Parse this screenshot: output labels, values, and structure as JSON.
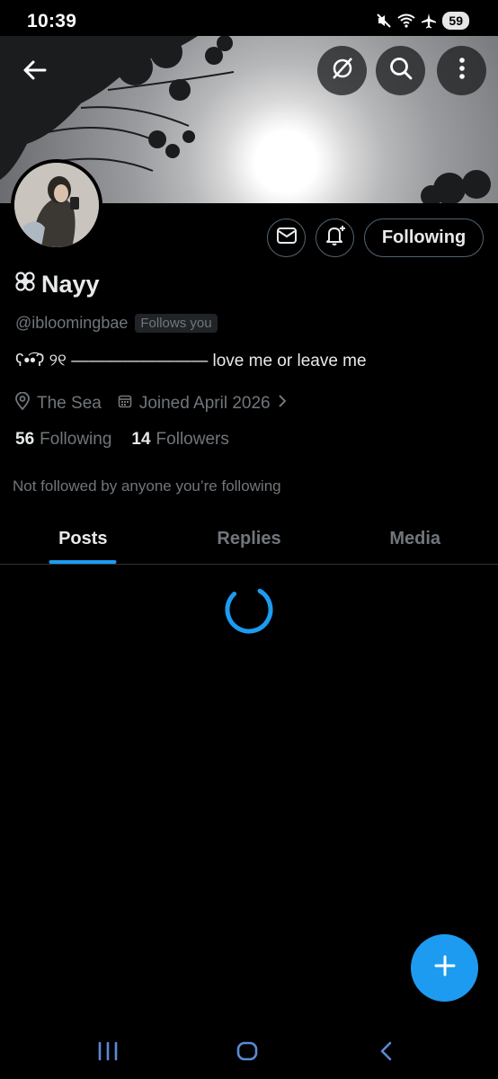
{
  "status_bar": {
    "time": "10:39",
    "battery": "59",
    "icons": [
      "mute-icon",
      "wifi-icon",
      "airplane-icon",
      "battery-icon"
    ]
  },
  "header": {
    "back_icon": "back-arrow-icon",
    "actions": [
      "grok-icon",
      "search-icon",
      "more-icon"
    ]
  },
  "profile": {
    "display_name": "Nayy",
    "handle": "@ibloomingbae",
    "follows_you": "Follows you",
    "bio": "ʕ•͡•ʔ ୨୧ ———————— love me or leave me",
    "location": "The Sea",
    "joined": "Joined April 2026",
    "following_count": "56",
    "following_label": "Following",
    "followers_count": "14",
    "followers_label": "Followers",
    "not_followed": "Not followed by anyone you’re following"
  },
  "actions": {
    "message_icon": "envelope-icon",
    "notify_icon": "bell-plus-icon",
    "following_button": "Following"
  },
  "tabs": [
    {
      "label": "Posts",
      "active": true
    },
    {
      "label": "Replies",
      "active": false
    },
    {
      "label": "Media",
      "active": false
    }
  ],
  "colors": {
    "accent": "#1d9bf0",
    "background": "#000000",
    "secondary_text": "#71767b"
  }
}
